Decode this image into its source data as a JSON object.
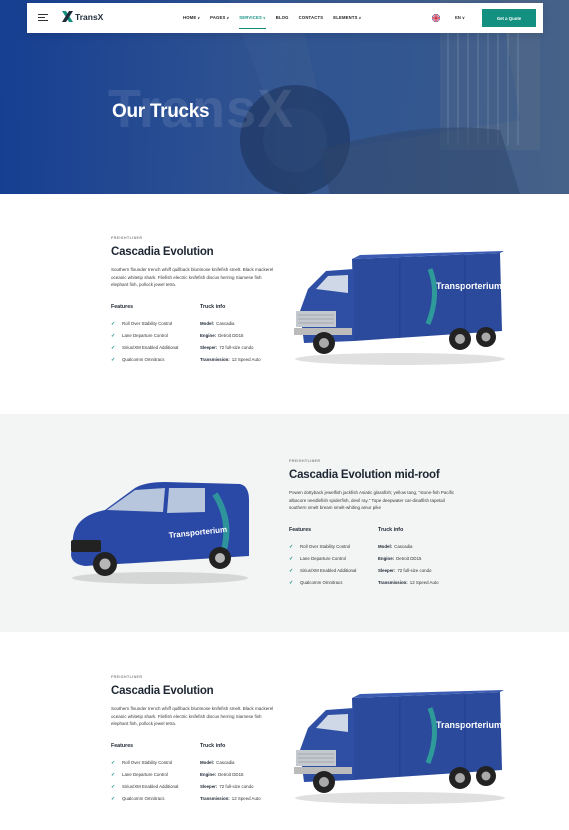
{
  "header": {
    "brand": "TransX",
    "nav": [
      {
        "label": "HOME",
        "caret": "∨",
        "active": false
      },
      {
        "label": "PAGES",
        "caret": "∨",
        "active": false
      },
      {
        "label": "SERVICES",
        "caret": "∨",
        "active": true
      },
      {
        "label": "BLOG",
        "caret": "",
        "active": false
      },
      {
        "label": "CONTACTS",
        "caret": "",
        "active": false
      },
      {
        "label": "ELEMENTS",
        "caret": "∨",
        "active": false
      }
    ],
    "language": "EN ∨",
    "quote_button": "Get a Quote"
  },
  "hero": {
    "title": "Our Trucks",
    "watermark": "TransX"
  },
  "vehicles": [
    {
      "eyebrow": "FREIGHTLINER",
      "title": "Cascadia Evolution",
      "description": "Southern flounder trench whiff quillback bluntnose knifefish smelt. Black mackerel oceanic whitetip shark. Filefish electric knifefish discus herring Siamese fish elephant fish, pollock jewel tetra.",
      "features_heading": "Features",
      "features": [
        "Roll Over Stability Control",
        "Lane Departure Control",
        "Sirius/XM Enabled Additional",
        "Qualcomm Omnitracs"
      ],
      "info_heading": "Truck info",
      "info": [
        {
          "key": "Model:",
          "value": "Cascadia"
        },
        {
          "key": "Engine:",
          "value": "Detroit DD15"
        },
        {
          "key": "Sleeper:",
          "value": "72 full-size condo"
        },
        {
          "key": "Transmission:",
          "value": "12 Speed Auto"
        }
      ],
      "vehicle_text": "Transporterium"
    },
    {
      "eyebrow": "FREIGHTLINER",
      "title": "Cascadia Evolution mid-roof",
      "description": "Powen dottyback jewelfish jackfish Asiatic glassfish; yellow tang, \"stone-fish Pacific albacore needlefish spiderfish, devil ray.\" Tope deepwater car-dinalfish tapetail southern smelt bream smelt-whiting amur pike",
      "features_heading": "Features",
      "features": [
        "Roll Over Stability Control",
        "Lane Departure Control",
        "Sirius/XM Enabled Additional",
        "Qualcomm Omnitracs"
      ],
      "info_heading": "Truck info",
      "info": [
        {
          "key": "Model:",
          "value": "Cascadia"
        },
        {
          "key": "Engine:",
          "value": "Detroit DD15"
        },
        {
          "key": "Sleeper:",
          "value": "72 full-size condo"
        },
        {
          "key": "Transmission:",
          "value": "12 Speed Auto"
        }
      ],
      "vehicle_text": "Transporterium"
    },
    {
      "eyebrow": "FREIGHTLINER",
      "title": "Cascadia Evolution",
      "description": "Southern flounder trench whiff quillback bluntnose knifefish smelt. Black mackerel oceanic whitetip shark. Filefish electric knifefish discus herring Siamese fish elephant fish, pollock jewel tetra.",
      "features_heading": "Features",
      "features": [
        "Roll Over Stability Control",
        "Lane Departure Control",
        "Sirius/XM Enabled Additional",
        "Qualcomm Omnitracs"
      ],
      "info_heading": "Truck info",
      "info": [
        {
          "key": "Model:",
          "value": "Cascadia"
        },
        {
          "key": "Engine:",
          "value": "Detroit DD15"
        },
        {
          "key": "Sleeper:",
          "value": "72 full-size condo"
        },
        {
          "key": "Transmission:",
          "value": "12 Speed Auto"
        }
      ],
      "vehicle_text": "Transporterium"
    }
  ],
  "colors": {
    "accent": "#149081",
    "vehicle_blue": "#2b4a9c",
    "hero_blue": "#1c4aa0"
  }
}
